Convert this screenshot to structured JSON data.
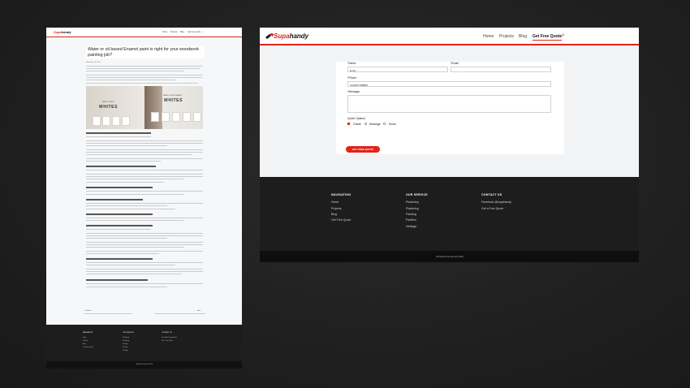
{
  "brand": {
    "name_a": "Supa",
    "name_b": "handy",
    "accent": "#e2231a"
  },
  "nav": {
    "items": [
      "Home",
      "Projects",
      "Blog",
      "Get Free Quote"
    ],
    "active": "Get Free Quote"
  },
  "blog": {
    "title": "Water or oil based Enamel paint is right for your woodwork painting job?",
    "date": "November 19, 2024",
    "hero": {
      "left_caption": "MOST LOVED",
      "left_big": "WHITES",
      "right_caption": "NEWLY DISCOVERED",
      "right_big": "WHITES"
    },
    "headings": [
      "Different Sheen / Water based paint VS Oil based paint",
      "Different Sheen Qualities / Water based paint VS Oil based paint",
      "Different Durability / Water based paint VS Oil based paint",
      "Water based Paint Better Use for Exterior",
      "Different Durability / Water based paint VS Oil based paint",
      "Different Durability / Water based paint VS Oil based paint",
      "Different Durability / Water based paint VS Oil based paint"
    ],
    "prev_label": "Previous",
    "next_label": "Next"
  },
  "form": {
    "section_title": "Free Quote",
    "name_label": "*Name",
    "name_value": "Emily",
    "email_label": "*Email",
    "email_value": "",
    "phone_label": "*Phone",
    "phone_value": "1234567788888",
    "message_label": "*Message",
    "message_value": "",
    "options_label": "Quote Options:",
    "options": [
      {
        "label": "Onsite",
        "checked": true
      },
      {
        "label": "Message",
        "checked": false
      },
      {
        "label": "Email",
        "checked": false
      }
    ],
    "submit_label": "GET FREE QUOTE"
  },
  "footer": {
    "nav_heading": "NAVIGATION",
    "nav_links": [
      "Home",
      "Projects",
      "Blog",
      "Get Free Quote"
    ],
    "service_heading": "OUR SERVICE",
    "service_links": [
      "Plastering",
      "Plastering",
      "Painting",
      "Partition",
      "Heritage"
    ],
    "contact_heading": "CONTACT US",
    "contact_links": [
      "Facebook @supahandy",
      "Get a Free Quote"
    ],
    "copyright": "All Rights Reserved 2024"
  }
}
